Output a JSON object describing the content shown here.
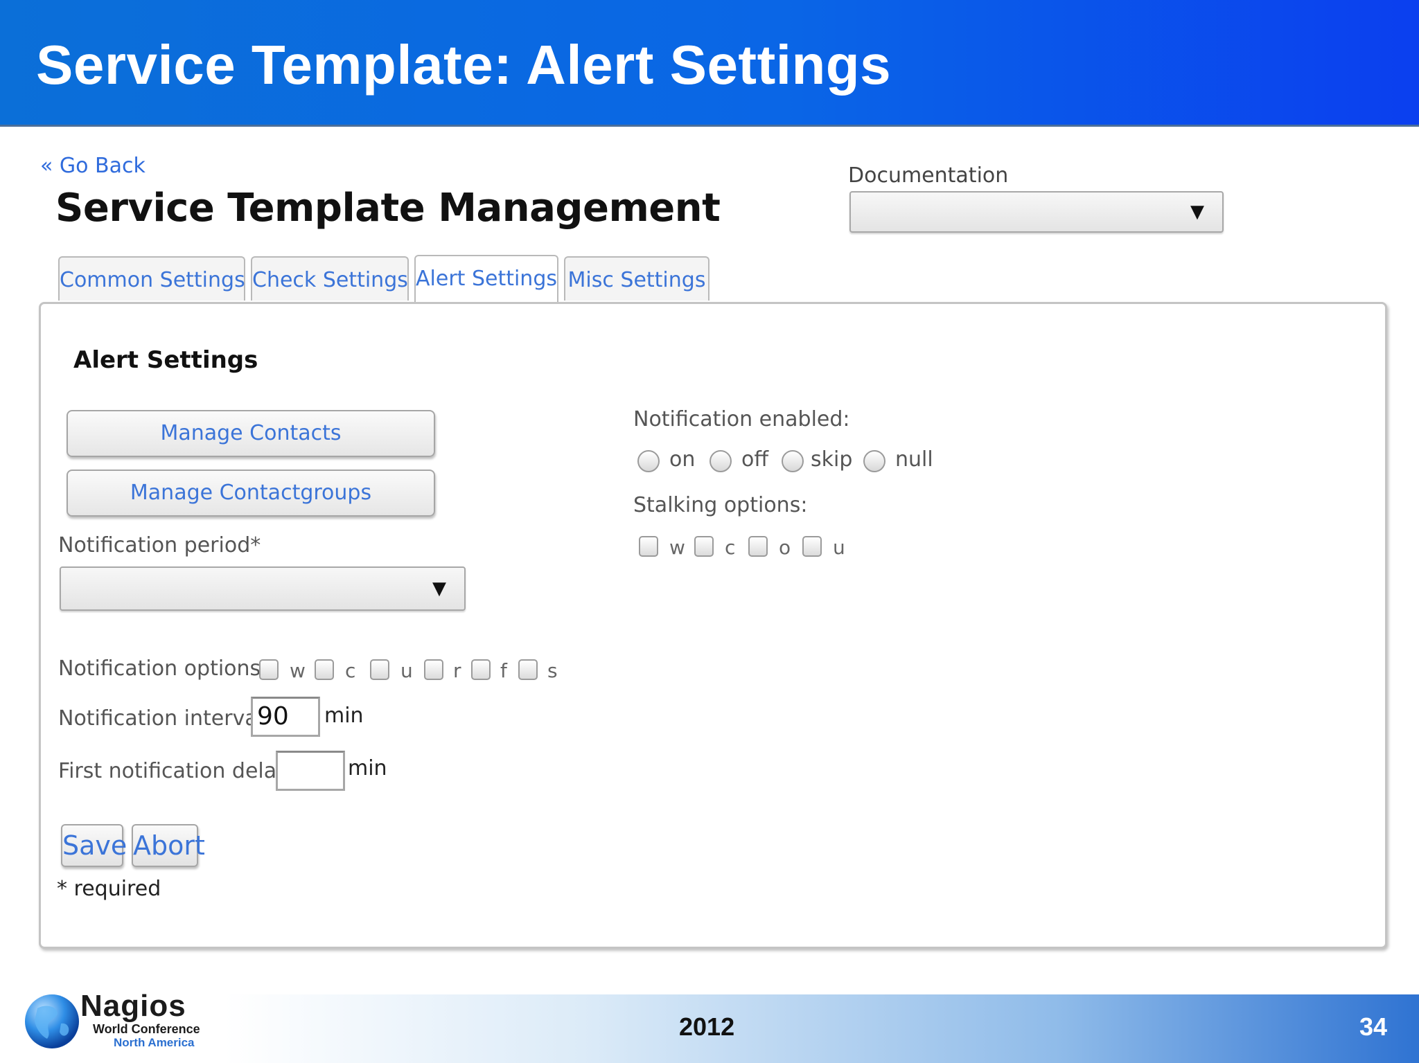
{
  "slide": {
    "title": "Service Template: Alert Settings",
    "footer_year": "2012",
    "page_number": "34",
    "logo": {
      "name": "Nagios",
      "line1": "World Conference",
      "line2": "North America"
    }
  },
  "app": {
    "go_back": "« Go Back",
    "page_title": "Service Template Management",
    "documentation": {
      "label": "Documentation",
      "value": ""
    },
    "tabs": [
      {
        "label": "Common Settings",
        "active": false
      },
      {
        "label": "Check Settings",
        "active": false
      },
      {
        "label": "Alert Settings",
        "active": true
      },
      {
        "label": "Misc Settings",
        "active": false
      }
    ],
    "panel": {
      "section_title": "Alert Settings",
      "manage_contacts": "Manage Contacts",
      "manage_contactgroups": "Manage Contactgroups",
      "notification_period": {
        "label": "Notification period*",
        "value": ""
      },
      "notification_options": {
        "label": "Notification options:",
        "options": [
          "w",
          "c",
          "u",
          "r",
          "f",
          "s"
        ]
      },
      "notification_interval": {
        "label": "Notification interval",
        "value": "90",
        "unit": "min"
      },
      "first_notification_delay": {
        "label": "First notification delay",
        "value": "",
        "unit": "min"
      },
      "notification_enabled": {
        "label": "Notification enabled:",
        "options": [
          "on",
          "off",
          "skip",
          "null"
        ]
      },
      "stalking_options": {
        "label": "Stalking options:",
        "options": [
          "w",
          "c",
          "o",
          "u"
        ]
      },
      "save": "Save",
      "abort": "Abort",
      "required_note": "* required"
    }
  }
}
